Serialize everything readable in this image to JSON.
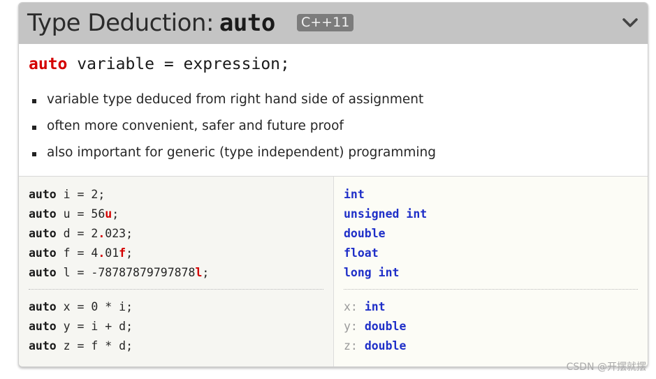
{
  "header": {
    "title_text": "Type Deduction:",
    "title_keyword": "auto",
    "badge": "C++11",
    "collapse_icon": "chevron-down-icon"
  },
  "syntax": {
    "keyword": "auto",
    "rest": " variable = expression;"
  },
  "bullets": [
    "variable type deduced from right hand side of assignment",
    "often more convenient, safer and future proof",
    "also important for generic (type independent) programming"
  ],
  "examples": {
    "group1": [
      {
        "kw": "auto",
        "pre": " i = 2;",
        "mark": "",
        "post": ""
      },
      {
        "kw": "auto",
        "pre": " u = 56",
        "mark": "u",
        "post": ";"
      },
      {
        "kw": "auto",
        "pre": " d = 2",
        "mark": ".",
        "post": "023;"
      },
      {
        "kw": "auto",
        "pre": " f = 4",
        "mark": ".",
        "post": "01",
        "mark2": "f",
        "post2": ";"
      },
      {
        "kw": "auto",
        "pre": " l = -78787879797878",
        "mark": "l",
        "post": ";"
      }
    ],
    "group2": [
      {
        "kw": "auto",
        "pre": " x = 0 * i;"
      },
      {
        "kw": "auto",
        "pre": " y = i + d;"
      },
      {
        "kw": "auto",
        "pre": " z = f * d;"
      }
    ]
  },
  "types": {
    "group1": [
      "int",
      "unsigned int",
      "double",
      "float",
      "long int"
    ],
    "group2": [
      {
        "var": "x:",
        "type": "int"
      },
      {
        "var": "y:",
        "type": "double"
      },
      {
        "var": "z:",
        "type": "double"
      }
    ]
  },
  "watermark": "CSDN @开摆就摆",
  "colors": {
    "header_bg": "#c4c4c4",
    "keyword_red": "#d40000",
    "type_blue": "#1f2fc8"
  }
}
